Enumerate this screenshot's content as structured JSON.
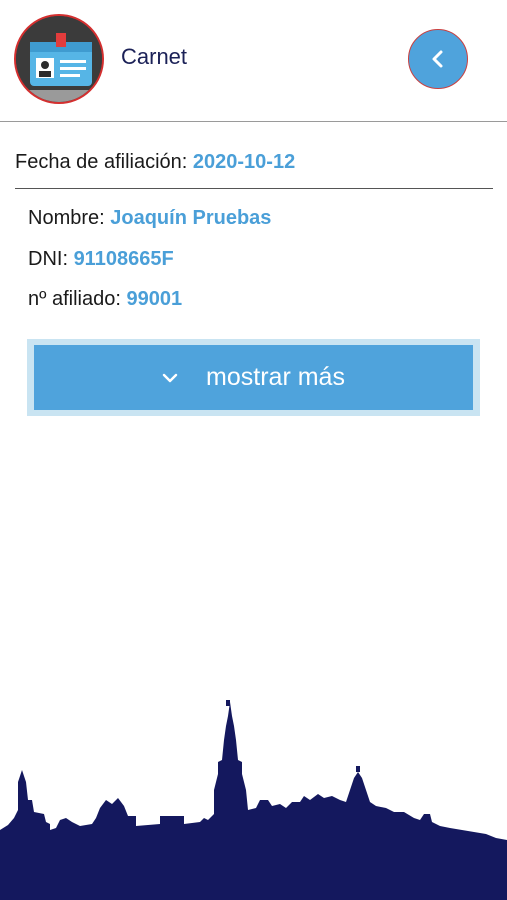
{
  "header": {
    "title": "Carnet",
    "back_icon": "chevron-left-icon",
    "avatar_icon": "id-card-icon"
  },
  "affiliation": {
    "date_label": "Fecha de afiliación: ",
    "date_value": "2020-10-12"
  },
  "fields": [
    {
      "label": "Nombre: ",
      "value": "Joaquín Pruebas"
    },
    {
      "label": "DNI: ",
      "value": "91108665F"
    },
    {
      "label": "nº afiliado: ",
      "value": "99001"
    }
  ],
  "expand_button": {
    "label": "mostrar más",
    "icon": "chevron-down-icon"
  },
  "colors": {
    "accent": "#4fa3dc",
    "value_text": "#4a9fd8",
    "title": "#1b2157",
    "skyline": "#14185e"
  }
}
